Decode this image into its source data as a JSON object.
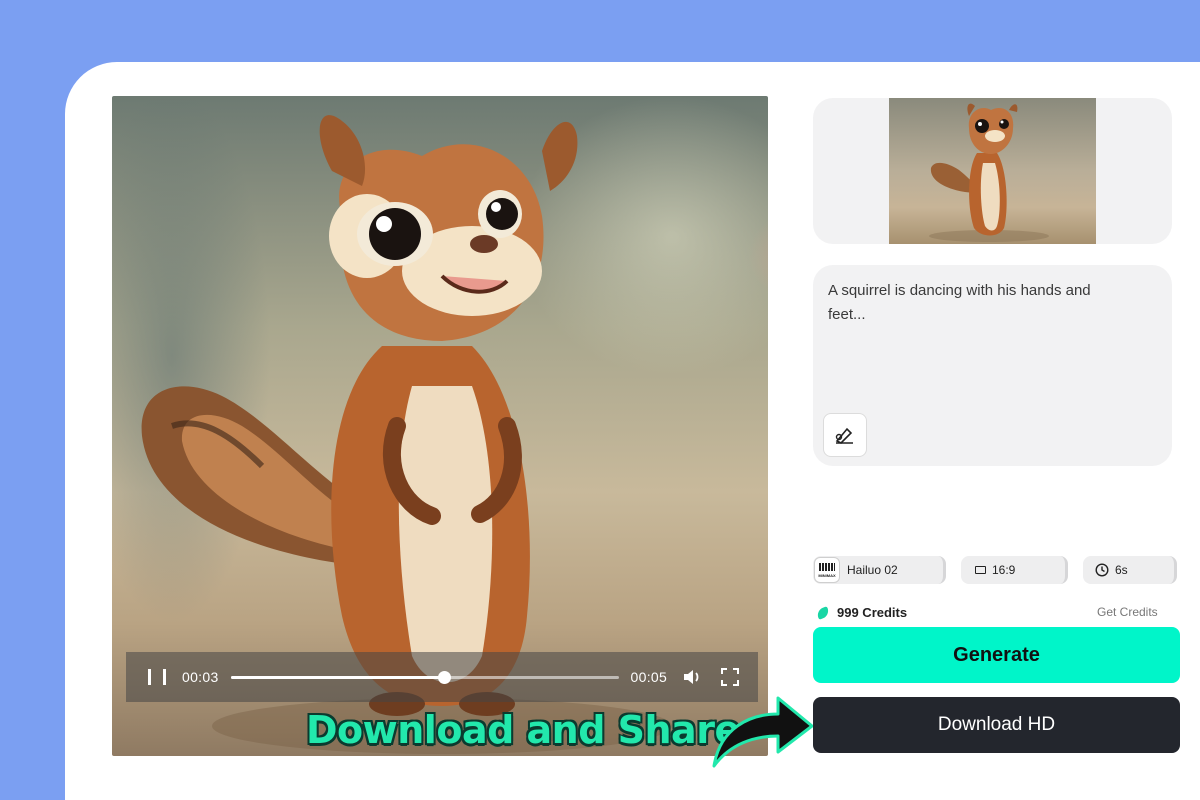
{
  "player": {
    "current_time": "00:03",
    "duration": "00:05",
    "progress_fraction": 0.55
  },
  "overlay": {
    "caption": "Download and Share"
  },
  "prompt": {
    "text": "A squirrel is dancing with his hands and feet..."
  },
  "settings": {
    "model_label": "Hailuo 02",
    "model_logo_text": "MINIMAX",
    "aspect_ratio": "16:9",
    "duration": "6s"
  },
  "credits": {
    "balance_label": "999 Credits",
    "get_credits_label": "Get Credits"
  },
  "actions": {
    "generate_label": "Generate",
    "download_label": "Download HD"
  },
  "colors": {
    "background": "#7b9ff2",
    "accent": "#00f5c9",
    "dark_button": "#23262d",
    "caption_green": "#22e8ac"
  },
  "icons": [
    "pause-icon",
    "volume-icon",
    "fullscreen-icon",
    "edit-prompt-icon",
    "aspect-ratio-icon",
    "clock-icon",
    "credits-gem-icon",
    "curved-arrow-icon"
  ]
}
